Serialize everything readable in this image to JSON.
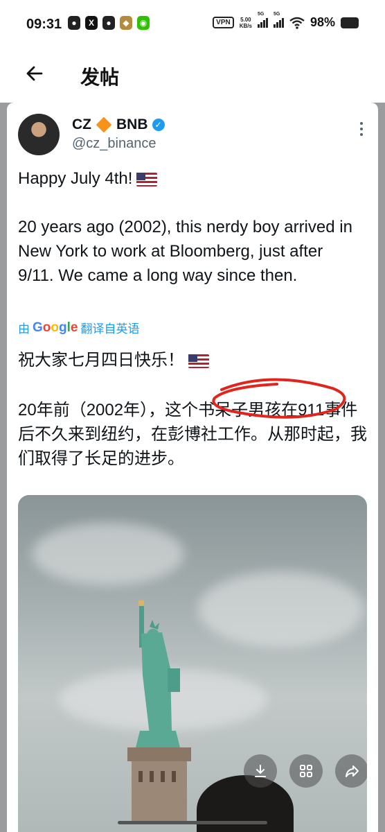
{
  "status_bar": {
    "time": "09:31",
    "app_icons": [
      "qq-icon",
      "x-icon",
      "qq-icon",
      "game-icon",
      "wechat-icon"
    ],
    "vpn": "VPN",
    "net_speed": "5.00",
    "net_unit": "KB/s",
    "sim1": "5G",
    "sim2": "5G",
    "battery": "98%"
  },
  "header": {
    "title": "发帖"
  },
  "tweet": {
    "author_name": "CZ",
    "author_name_suffix": "BNB",
    "handle": "@cz_binance",
    "line1": "Happy July 4th!",
    "body": "20 years ago (2002), this nerdy boy arrived in New York to work at Bloomberg, just after 9/11. We came a long way since then.",
    "translate_prefix": "由",
    "translate_brand": "Google",
    "translate_suffix": "翻译自英语",
    "translated_line1": "祝大家七月四日快乐！",
    "translated_body": "20年前（2002年），这个书呆子男孩在911事件后不久来到纽约，在彭博社工作。从那时起，我们取得了长足的进步。"
  },
  "colors": {
    "link_blue": "#1d9bf0",
    "annotation_red": "#e0251c",
    "bnb_orange": "#f7931a"
  }
}
